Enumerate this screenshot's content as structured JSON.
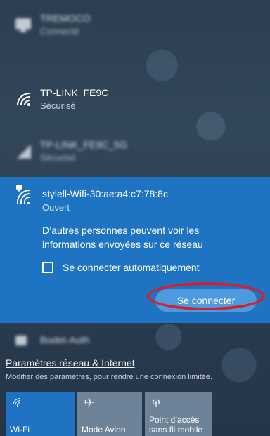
{
  "networks": [
    {
      "name": "TREMOCO",
      "status": "Connecté",
      "blurred": true
    },
    {
      "name": "TP-LINK_FE9C",
      "status": "Sécurisé",
      "blurred": false
    },
    {
      "name": "TP-LINK_FE9C_5G",
      "status": "Sécurisé",
      "blurred": true
    }
  ],
  "selected_network": {
    "name": "stylell-Wifi-30:ae:a4:c7:78:8c",
    "status": "Ouvert",
    "warning": "D’autres personnes peuvent voir les informations envoyées sur ce réseau",
    "auto_connect_label": "Se connecter automatiquement",
    "auto_connect_checked": false,
    "connect_button": "Se connecter"
  },
  "next_network": {
    "name": "Bodet-Auth",
    "blurred": true
  },
  "settings": {
    "link": "Paramètres réseau & Internet",
    "hint": "Modifier des paramètres, pour rendre une connexion limitée."
  },
  "quick_actions": [
    {
      "label": "Wi-Fi",
      "icon": "wifi-icon",
      "active": true
    },
    {
      "label": "Mode Avion",
      "icon": "airplane-icon",
      "active": false
    },
    {
      "label1": "Point d’accès",
      "label2": "sans fil mobile",
      "icon": "hotspot-icon",
      "active": false
    }
  ],
  "colors": {
    "accent": "#1e73c2",
    "annotation": "#d2222a",
    "button": "#4d9ae0"
  }
}
